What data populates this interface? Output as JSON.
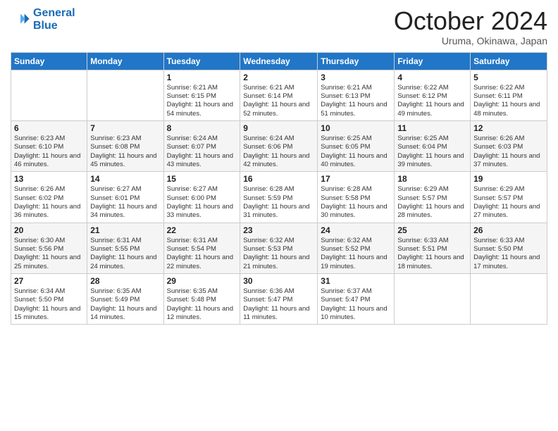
{
  "logo": {
    "line1": "General",
    "line2": "Blue"
  },
  "title": "October 2024",
  "location": "Uruma, Okinawa, Japan",
  "days_of_week": [
    "Sunday",
    "Monday",
    "Tuesday",
    "Wednesday",
    "Thursday",
    "Friday",
    "Saturday"
  ],
  "weeks": [
    [
      {
        "day": "",
        "info": ""
      },
      {
        "day": "",
        "info": ""
      },
      {
        "day": "1",
        "info": "Sunrise: 6:21 AM\nSunset: 6:15 PM\nDaylight: 11 hours and 54 minutes."
      },
      {
        "day": "2",
        "info": "Sunrise: 6:21 AM\nSunset: 6:14 PM\nDaylight: 11 hours and 52 minutes."
      },
      {
        "day": "3",
        "info": "Sunrise: 6:21 AM\nSunset: 6:13 PM\nDaylight: 11 hours and 51 minutes."
      },
      {
        "day": "4",
        "info": "Sunrise: 6:22 AM\nSunset: 6:12 PM\nDaylight: 11 hours and 49 minutes."
      },
      {
        "day": "5",
        "info": "Sunrise: 6:22 AM\nSunset: 6:11 PM\nDaylight: 11 hours and 48 minutes."
      }
    ],
    [
      {
        "day": "6",
        "info": "Sunrise: 6:23 AM\nSunset: 6:10 PM\nDaylight: 11 hours and 46 minutes."
      },
      {
        "day": "7",
        "info": "Sunrise: 6:23 AM\nSunset: 6:08 PM\nDaylight: 11 hours and 45 minutes."
      },
      {
        "day": "8",
        "info": "Sunrise: 6:24 AM\nSunset: 6:07 PM\nDaylight: 11 hours and 43 minutes."
      },
      {
        "day": "9",
        "info": "Sunrise: 6:24 AM\nSunset: 6:06 PM\nDaylight: 11 hours and 42 minutes."
      },
      {
        "day": "10",
        "info": "Sunrise: 6:25 AM\nSunset: 6:05 PM\nDaylight: 11 hours and 40 minutes."
      },
      {
        "day": "11",
        "info": "Sunrise: 6:25 AM\nSunset: 6:04 PM\nDaylight: 11 hours and 39 minutes."
      },
      {
        "day": "12",
        "info": "Sunrise: 6:26 AM\nSunset: 6:03 PM\nDaylight: 11 hours and 37 minutes."
      }
    ],
    [
      {
        "day": "13",
        "info": "Sunrise: 6:26 AM\nSunset: 6:02 PM\nDaylight: 11 hours and 36 minutes."
      },
      {
        "day": "14",
        "info": "Sunrise: 6:27 AM\nSunset: 6:01 PM\nDaylight: 11 hours and 34 minutes."
      },
      {
        "day": "15",
        "info": "Sunrise: 6:27 AM\nSunset: 6:00 PM\nDaylight: 11 hours and 33 minutes."
      },
      {
        "day": "16",
        "info": "Sunrise: 6:28 AM\nSunset: 5:59 PM\nDaylight: 11 hours and 31 minutes."
      },
      {
        "day": "17",
        "info": "Sunrise: 6:28 AM\nSunset: 5:58 PM\nDaylight: 11 hours and 30 minutes."
      },
      {
        "day": "18",
        "info": "Sunrise: 6:29 AM\nSunset: 5:57 PM\nDaylight: 11 hours and 28 minutes."
      },
      {
        "day": "19",
        "info": "Sunrise: 6:29 AM\nSunset: 5:57 PM\nDaylight: 11 hours and 27 minutes."
      }
    ],
    [
      {
        "day": "20",
        "info": "Sunrise: 6:30 AM\nSunset: 5:56 PM\nDaylight: 11 hours and 25 minutes."
      },
      {
        "day": "21",
        "info": "Sunrise: 6:31 AM\nSunset: 5:55 PM\nDaylight: 11 hours and 24 minutes."
      },
      {
        "day": "22",
        "info": "Sunrise: 6:31 AM\nSunset: 5:54 PM\nDaylight: 11 hours and 22 minutes."
      },
      {
        "day": "23",
        "info": "Sunrise: 6:32 AM\nSunset: 5:53 PM\nDaylight: 11 hours and 21 minutes."
      },
      {
        "day": "24",
        "info": "Sunrise: 6:32 AM\nSunset: 5:52 PM\nDaylight: 11 hours and 19 minutes."
      },
      {
        "day": "25",
        "info": "Sunrise: 6:33 AM\nSunset: 5:51 PM\nDaylight: 11 hours and 18 minutes."
      },
      {
        "day": "26",
        "info": "Sunrise: 6:33 AM\nSunset: 5:50 PM\nDaylight: 11 hours and 17 minutes."
      }
    ],
    [
      {
        "day": "27",
        "info": "Sunrise: 6:34 AM\nSunset: 5:50 PM\nDaylight: 11 hours and 15 minutes."
      },
      {
        "day": "28",
        "info": "Sunrise: 6:35 AM\nSunset: 5:49 PM\nDaylight: 11 hours and 14 minutes."
      },
      {
        "day": "29",
        "info": "Sunrise: 6:35 AM\nSunset: 5:48 PM\nDaylight: 11 hours and 12 minutes."
      },
      {
        "day": "30",
        "info": "Sunrise: 6:36 AM\nSunset: 5:47 PM\nDaylight: 11 hours and 11 minutes."
      },
      {
        "day": "31",
        "info": "Sunrise: 6:37 AM\nSunset: 5:47 PM\nDaylight: 11 hours and 10 minutes."
      },
      {
        "day": "",
        "info": ""
      },
      {
        "day": "",
        "info": ""
      }
    ]
  ]
}
